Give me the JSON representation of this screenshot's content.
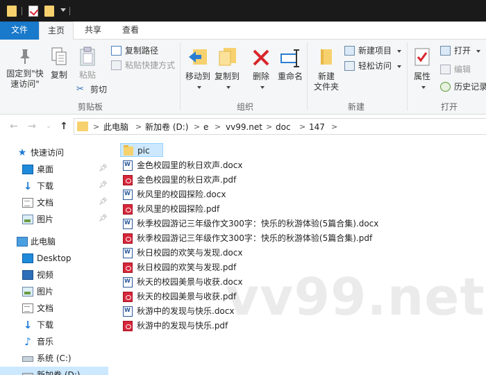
{
  "tabs": {
    "file": "文件",
    "home": "主页",
    "share": "共享",
    "view": "查看"
  },
  "ribbon": {
    "clipboard": {
      "label": "剪贴板",
      "pin_line1": "固定到\"快",
      "pin_line2": "速访问\"",
      "copy": "复制",
      "paste": "粘贴",
      "copy_path": "复制路径",
      "paste_shortcut": "粘贴快捷方式",
      "cut": "剪切"
    },
    "organize": {
      "label": "组织",
      "move_to": "移动到",
      "copy_to": "复制到",
      "delete": "删除",
      "rename": "重命名"
    },
    "new": {
      "label": "新建",
      "new_folder_line1": "新建",
      "new_folder_line2": "文件夹",
      "new_item": "新建项目",
      "easy_access": "轻松访问"
    },
    "open": {
      "label": "打开",
      "properties": "属性",
      "open": "打开",
      "edit": "编辑",
      "history": "历史记录"
    }
  },
  "breadcrumb": [
    "此电脑",
    "新加卷 (D:)",
    "e",
    "vv99.net",
    "doc",
    "147"
  ],
  "nav": {
    "quick_access": "快速访问",
    "quick_items": [
      "桌面",
      "下载",
      "文档",
      "图片"
    ],
    "this_pc": "此电脑",
    "pc_items": [
      "Desktop",
      "视频",
      "图片",
      "文档",
      "下载",
      "音乐",
      "系统 (C:)",
      "新加卷 (D:)"
    ]
  },
  "files": [
    {
      "name": "pic",
      "type": "folder"
    },
    {
      "name": "金色校园里的秋日欢声.docx",
      "type": "word"
    },
    {
      "name": "金色校园里的秋日欢声.pdf",
      "type": "pdf"
    },
    {
      "name": "秋风里的校园探险.docx",
      "type": "word"
    },
    {
      "name": "秋风里的校园探险.pdf",
      "type": "pdf"
    },
    {
      "name": "秋季校园游记三年级作文300字：快乐的秋游体验(5篇合集).docx",
      "type": "word"
    },
    {
      "name": "秋季校园游记三年级作文300字：快乐的秋游体验(5篇合集).pdf",
      "type": "pdf"
    },
    {
      "name": "秋日校园的欢笑与发现.docx",
      "type": "word"
    },
    {
      "name": "秋日校园的欢笑与发现.pdf",
      "type": "pdf"
    },
    {
      "name": "秋天的校园美景与收获.docx",
      "type": "word"
    },
    {
      "name": "秋天的校园美景与收获.pdf",
      "type": "pdf"
    },
    {
      "name": "秋游中的发现与快乐.docx",
      "type": "word"
    },
    {
      "name": "秋游中的发现与快乐.pdf",
      "type": "pdf"
    }
  ],
  "watermark": "vv99.net",
  "colors": {
    "accent": "#1979ca",
    "selection": "#cce8ff",
    "folder": "#f6d16d",
    "pdf": "#d6263a",
    "word": "#2b579a"
  }
}
